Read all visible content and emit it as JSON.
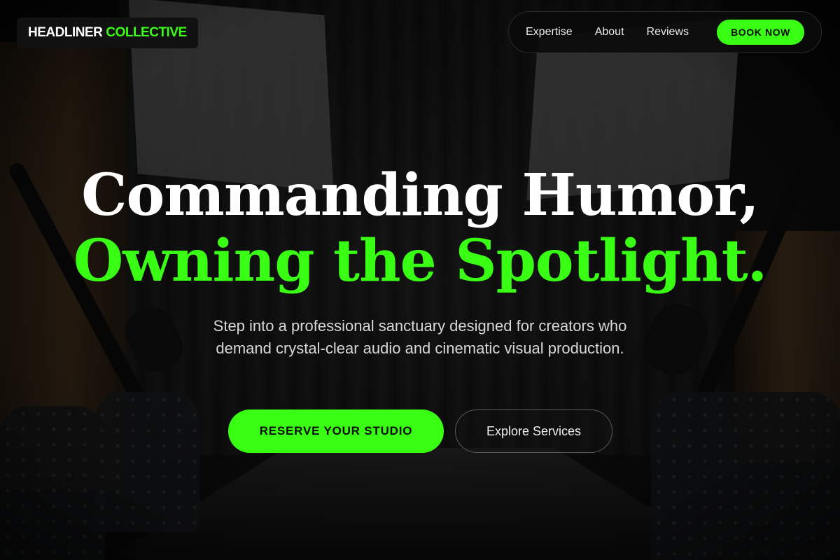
{
  "brand": {
    "logo_primary": "HEADLINER",
    "logo_accent": "COLLECTIVE",
    "accent_color": "#39ff14"
  },
  "nav": {
    "items": [
      {
        "label": "Expertise"
      },
      {
        "label": "About"
      },
      {
        "label": "Reviews"
      }
    ],
    "cta_label": "BOOK NOW"
  },
  "hero": {
    "headline_line1": "Commanding Humor,",
    "headline_line2": "Owning the Spotlight.",
    "subtitle": "Step into a professional sanctuary designed for creators who demand crystal-clear audio and cinematic visual production.",
    "primary_cta": "RESERVE YOUR STUDIO",
    "secondary_cta": "Explore Services"
  },
  "background": {
    "description_icon": "podcast-studio-backdrop"
  }
}
